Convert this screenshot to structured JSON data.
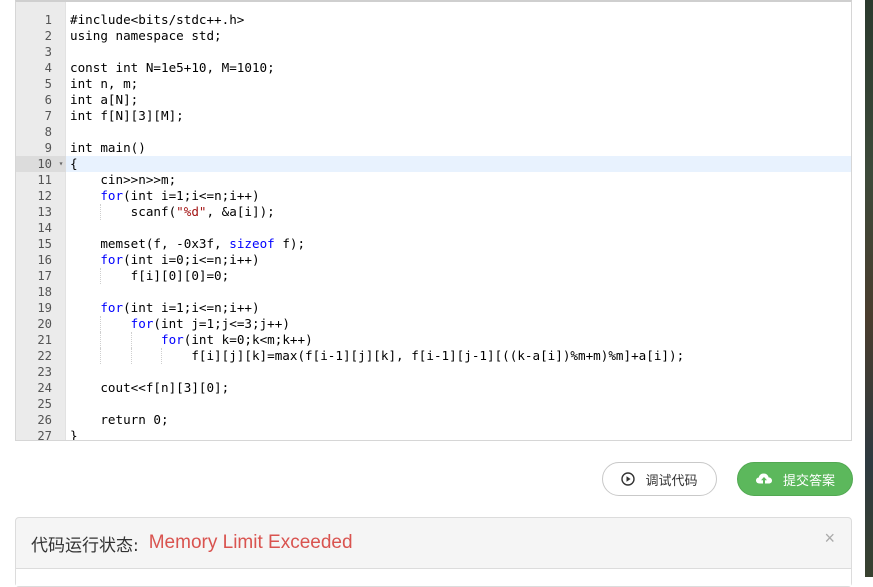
{
  "editor": {
    "active_line": 10,
    "fold_line": 10,
    "lines": [
      [
        {
          "t": "#include<bits/stdc++.h>"
        }
      ],
      [
        {
          "t": "using namespace std;"
        }
      ],
      [],
      [
        {
          "t": "const int N=1e5+10, M=1010;"
        }
      ],
      [
        {
          "t": "int n, m;"
        }
      ],
      [
        {
          "t": "int a[N];"
        }
      ],
      [
        {
          "t": "int f[N][3][M];"
        }
      ],
      [],
      [
        {
          "t": "int main()"
        }
      ],
      [
        {
          "t": "{"
        }
      ],
      [
        {
          "t": "    cin>>n>>m;"
        }
      ],
      [
        {
          "t": "    "
        },
        {
          "t": "for",
          "k": 1
        },
        {
          "t": "(int i=1;i<=n;i++)"
        }
      ],
      [
        {
          "t": "        scanf("
        },
        {
          "t": "\"%d\"",
          "s": 1
        },
        {
          "t": ", &a[i]);"
        }
      ],
      [],
      [
        {
          "t": "    memset(f, -0x3f, "
        },
        {
          "t": "sizeof",
          "k": 1
        },
        {
          "t": " f);"
        }
      ],
      [
        {
          "t": "    "
        },
        {
          "t": "for",
          "k": 1
        },
        {
          "t": "(int i=0;i<=n;i++)"
        }
      ],
      [
        {
          "t": "        f[i][0][0]=0;"
        }
      ],
      [],
      [
        {
          "t": "    "
        },
        {
          "t": "for",
          "k": 1
        },
        {
          "t": "(int i=1;i<=n;i++)"
        }
      ],
      [
        {
          "t": "        "
        },
        {
          "t": "for",
          "k": 1
        },
        {
          "t": "(int j=1;j<=3;j++)"
        }
      ],
      [
        {
          "t": "            "
        },
        {
          "t": "for",
          "k": 1
        },
        {
          "t": "(int k=0;k<m;k++)"
        }
      ],
      [
        {
          "t": "                f[i][j][k]=max(f[i-1][j][k], f[i-1][j-1][((k-a[i])%m+m)%m]+a[i]);"
        }
      ],
      [],
      [
        {
          "t": "    cout<<f[n][3][0];"
        }
      ],
      [],
      [
        {
          "t": "    return 0;"
        }
      ],
      [
        {
          "t": "}"
        }
      ]
    ]
  },
  "toolbar": {
    "debug_label": "调试代码",
    "submit_label": "提交答案"
  },
  "status": {
    "label": "代码运行状态:",
    "value": "Memory Limit Exceeded",
    "close": "×"
  },
  "colors": {
    "submit_bg": "#5cb85c",
    "status_error": "#d9534f",
    "keyword": "#0000ff",
    "active_line_bg": "#e8f2fe"
  },
  "icons": {
    "debug": "play-circle-icon",
    "submit": "cloud-upload-icon",
    "fold": "fold-arrow-icon"
  }
}
